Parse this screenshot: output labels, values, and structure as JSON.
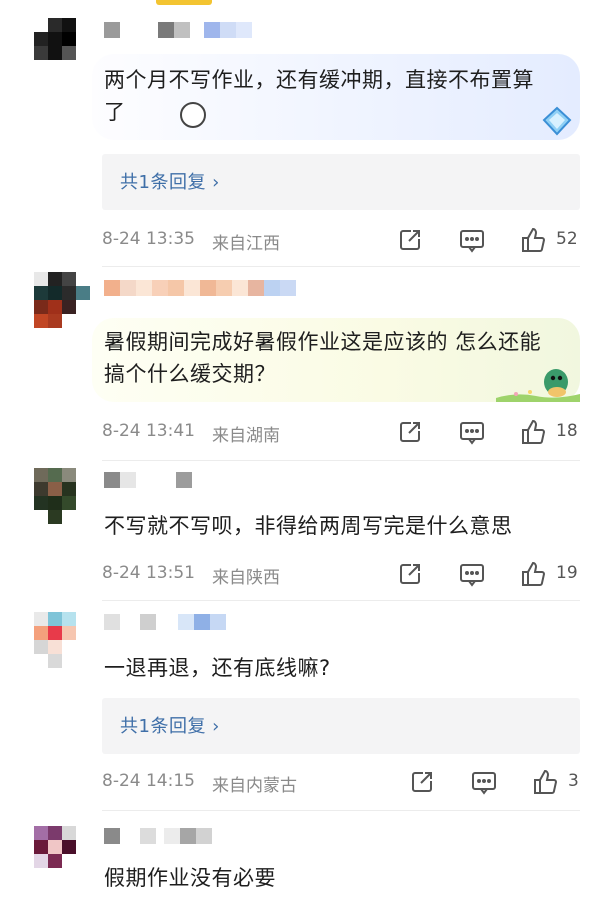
{
  "comments": [
    {
      "text": "两个月不写作业，还有缓冲期，直接不布置算了",
      "emoji": "face-emoji",
      "reply_label": "共1条回复 ›",
      "time": "8-24 13:35",
      "location": "来自江西",
      "likes": "52"
    },
    {
      "text": "暑假期间完成好暑假作业这是应该的 怎么还能搞个什么缓交期？",
      "time": "8-24 13:41",
      "location": "来自湖南",
      "likes": "18"
    },
    {
      "text": "不写就不写呗，非得给两周写完是什么意思",
      "time": "8-24 13:51",
      "location": "来自陕西",
      "likes": "19"
    },
    {
      "text": "一退再退，还有底线嘛?",
      "reply_label": "共1条回复 ›",
      "time": "8-24 14:15",
      "location": "来自内蒙古",
      "likes": "3"
    },
    {
      "text": "假期作业没有必要"
    }
  ],
  "icons": [
    "share-icon",
    "comment-icon",
    "like-icon"
  ],
  "colors": {
    "link": "#3f6fa8",
    "meta": "#8a8a8a",
    "reply_bg": "#f4f4f5",
    "indicator": "#f3c431"
  }
}
